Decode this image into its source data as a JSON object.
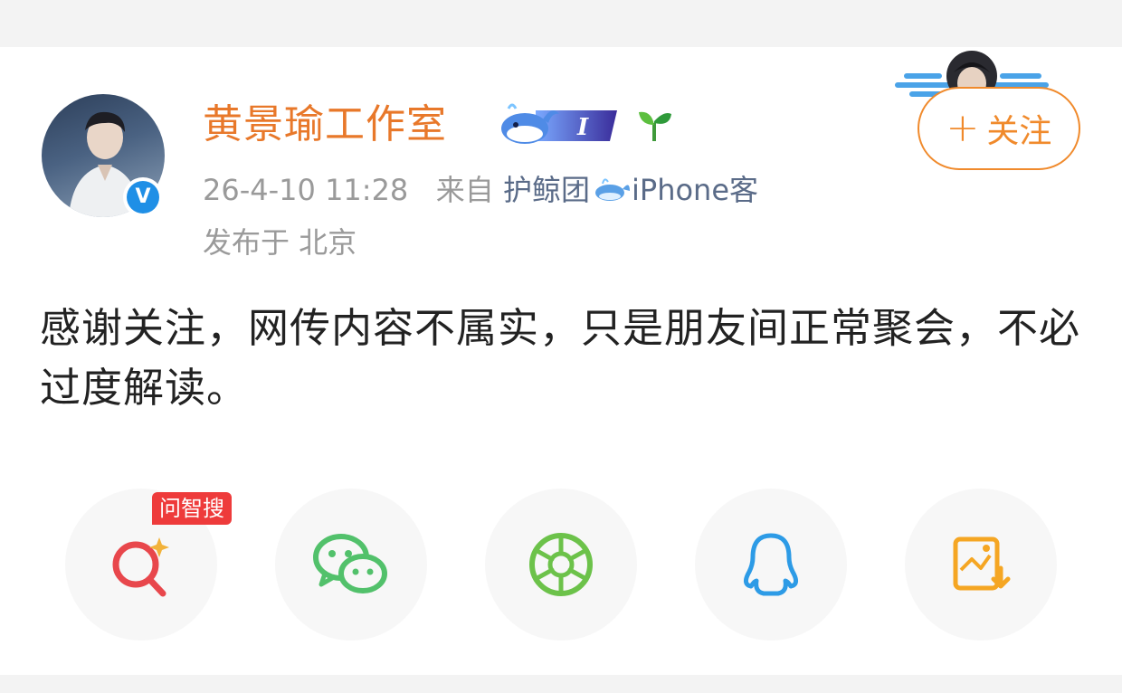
{
  "post": {
    "author": "黄景瑜工作室",
    "time": "26-4-10 11:28",
    "source_prefix": "来自",
    "source": "护鲸团",
    "source_device": "iPhone客",
    "location": "发布于 北京",
    "content": "感谢关注，网传内容不属实，只是朋友间正常聚会，不必过度解读。",
    "badge_level": "I",
    "verified_mark": "V"
  },
  "actions": {
    "follow_plus": "+",
    "follow_label": "关注"
  },
  "share": {
    "search_tag": "问智搜",
    "buttons": [
      {
        "icon": "ai-search-icon",
        "color": "#e8474c"
      },
      {
        "icon": "wechat-icon",
        "color": "#52c16b"
      },
      {
        "icon": "moments-icon",
        "color": "#6cc24a"
      },
      {
        "icon": "qq-icon",
        "color": "#2d9be6"
      },
      {
        "icon": "save-image-icon",
        "color": "#f5a623"
      }
    ]
  },
  "colors": {
    "author": "#e8782a",
    "follow": "#f08a2c",
    "meta": "#9a9a9a",
    "source": "#5a6b88",
    "text": "#222222",
    "verified": "#1f8fe6"
  }
}
